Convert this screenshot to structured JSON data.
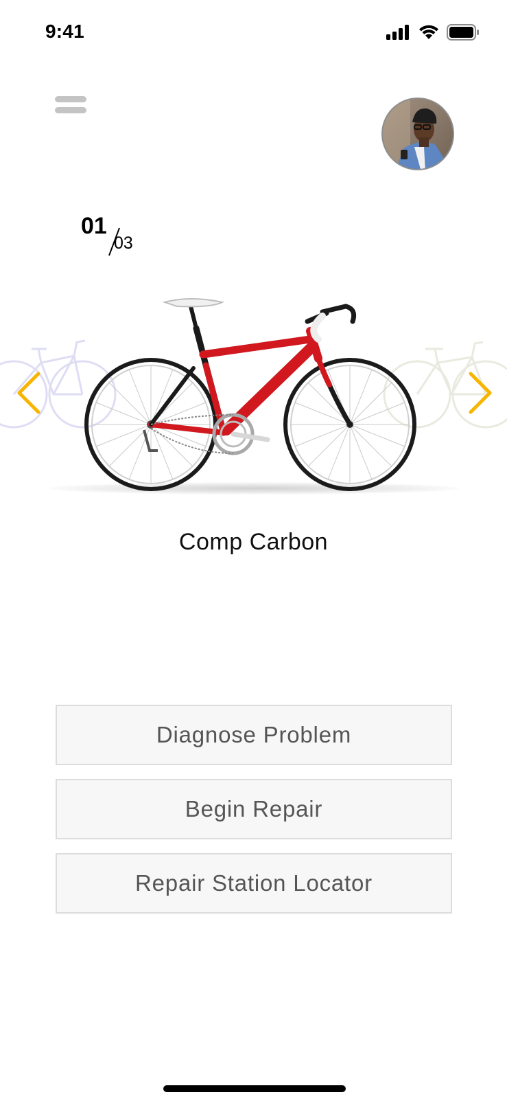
{
  "status_bar": {
    "time": "9:41",
    "icons": [
      "signal-icon",
      "wifi-icon",
      "battery-icon"
    ]
  },
  "header": {
    "menu_icon": "hamburger-menu-icon",
    "avatar_icon": "user-avatar"
  },
  "carousel": {
    "current": "01",
    "total": "03",
    "prev_icon": "chevron-left-icon",
    "next_icon": "chevron-right-icon",
    "accent_color": "#f7b500",
    "bike_colors": {
      "frame": "#d0181e",
      "accent_black": "#1a1a1a",
      "side_bike": "#b9b6e8"
    },
    "bike_name": "Comp Carbon"
  },
  "actions": [
    {
      "label": "Diagnose Problem"
    },
    {
      "label": "Begin Repair"
    },
    {
      "label": "Repair Station Locator"
    }
  ]
}
